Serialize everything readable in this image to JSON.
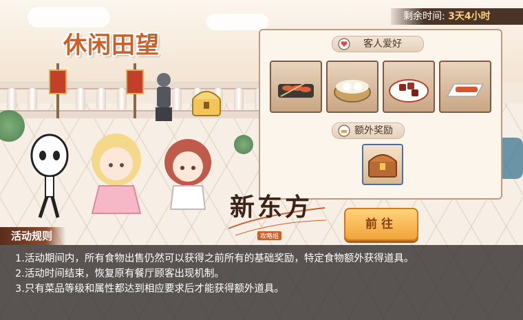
{
  "event": {
    "title": "休闲田望",
    "timer_label": "剩余时间:",
    "timer_value": "3天4小时"
  },
  "panel": {
    "guest_pref_header": "客人爱好",
    "dishes": [
      {
        "icon": "shrimp-skewer-icon"
      },
      {
        "icon": "dumpling-steamer-icon"
      },
      {
        "icon": "braised-meat-icon"
      },
      {
        "icon": "grilled-fish-icon"
      }
    ],
    "extra_reward_header": "额外奖励",
    "reward_icon": "treasure-chest-icon"
  },
  "go_button": {
    "label": "前往"
  },
  "logo": {
    "main": "新东方",
    "sub": "攻略组"
  },
  "rules": {
    "tag": "活动规则",
    "lines": [
      "1.活动期间内，所有食物出售仍然可以获得之前所有的基础奖励，特定食物额外获得道具。",
      "2.活动时间结束，恢复原有餐厅顾客出现机制。",
      "3.只有菜品等级和属性都达到相应要求后才能获得额外道具。"
    ]
  },
  "colors": {
    "title": "#c8622a",
    "button": "#f2a33a",
    "panel_border": "#b79b83",
    "rules_bg": "#2d2826"
  }
}
